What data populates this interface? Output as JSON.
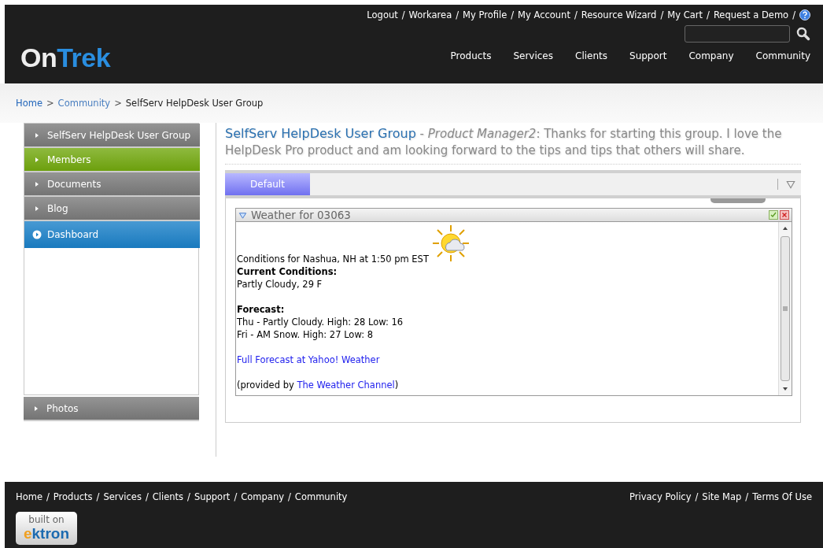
{
  "header": {
    "logo": {
      "part_1": "On",
      "part_2": "Trek"
    },
    "top_links": [
      "Logout",
      "Workarea",
      "My Profile",
      "My Account",
      "Resource Wizard",
      "My Cart",
      "Request a Demo"
    ],
    "separator": "/",
    "nav": [
      "Products",
      "Services",
      "Clients",
      "Support",
      "Company",
      "Community"
    ]
  },
  "breadcrumb": {
    "links": [
      "Home",
      "Community"
    ],
    "separator": ">",
    "current": "SelfServ HelpDesk User Group"
  },
  "sidebar": {
    "items": [
      {
        "label": "SelfServ HelpDesk User Group",
        "selected": false,
        "color": "#7a7a7a"
      },
      {
        "label": "Members",
        "selected": false,
        "color": "#72a80e"
      },
      {
        "label": "Documents",
        "selected": false,
        "color": "#7a7a7a"
      },
      {
        "label": "Blog",
        "selected": false,
        "color": "#7a7a7a"
      },
      {
        "label": "Dashboard",
        "selected": true,
        "color": "#1a80c8"
      }
    ],
    "bottom_items": [
      {
        "label": "Photos",
        "selected": false,
        "color": "#7a7a7a"
      }
    ]
  },
  "intro": {
    "title": "SelfServ HelpDesk User Group",
    "text": "- *Product Manager2*: Thanks for starting this group. I love the HelpDesk Pro product and am looking forward to the tips and tips that others will share."
  },
  "tabs": [
    {
      "label": "Default",
      "selected": true
    }
  ],
  "widget": {
    "title": "Weather for 03063",
    "conditions": "Conditions for Nashua, NH at 1:50 pm EST",
    "current_heading": "Current Conditions:",
    "current": "Partly Cloudy, 29 F",
    "forecast_heading": "Forecast:",
    "forecast": [
      "Thu - Partly Cloudy. High: 28 Low: 16",
      "Fri - AM Snow. High: 27 Low: 8"
    ],
    "full_link": "Full Forecast at Yahoo! Weather",
    "provided_prefix": "(provided by",
    "provided_link": "The Weather Channel",
    "provided_suffix": ")"
  },
  "footer": {
    "links": [
      "Home",
      "Products",
      "Services",
      "Clients",
      "Support",
      "Company",
      "Community"
    ],
    "legal": [
      "Privacy Policy",
      "Site Map",
      "Terms Of Use"
    ],
    "badge": {
      "line_1": "built on",
      "brand_1": "e",
      "brand_2": "ktron"
    }
  }
}
